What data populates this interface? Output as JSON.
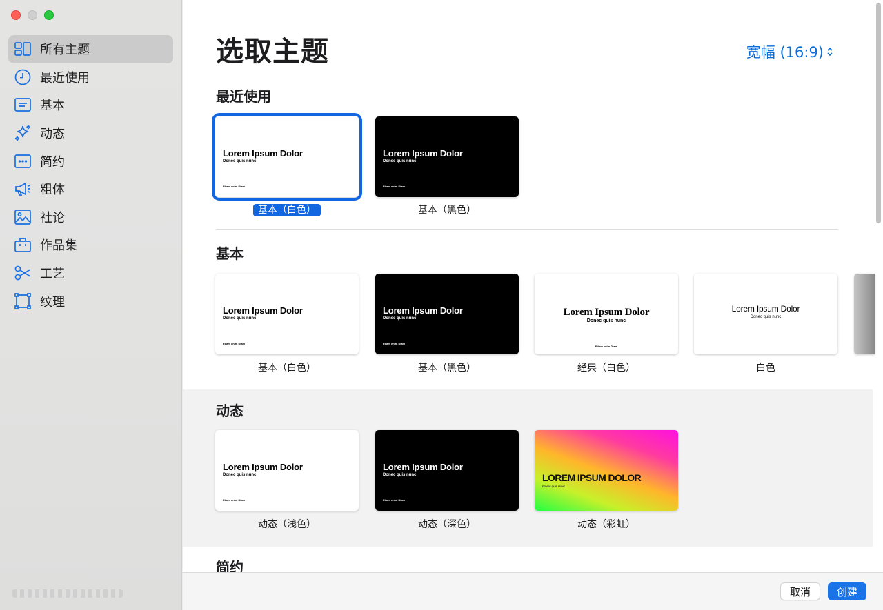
{
  "sidebar": {
    "items": [
      {
        "label": "所有主题",
        "icon": "grid-icon"
      },
      {
        "label": "最近使用",
        "icon": "clock-icon"
      },
      {
        "label": "基本",
        "icon": "text-lines-icon"
      },
      {
        "label": "动态",
        "icon": "sparkles-icon"
      },
      {
        "label": "简约",
        "icon": "dots-box-icon"
      },
      {
        "label": "粗体",
        "icon": "megaphone-icon"
      },
      {
        "label": "社论",
        "icon": "photo-icon"
      },
      {
        "label": "作品集",
        "icon": "briefcase-icon"
      },
      {
        "label": "工艺",
        "icon": "scissors-icon"
      },
      {
        "label": "纹理",
        "icon": "frame-icon"
      }
    ],
    "active_index": 0
  },
  "main": {
    "title": "选取主题",
    "ratio_label": "宽幅 (16:9)",
    "sections": {
      "recent": {
        "heading": "最近使用",
        "themes": [
          {
            "name": "基本（白色）",
            "style": "white"
          },
          {
            "name": "基本（黑色）",
            "style": "black"
          }
        ]
      },
      "basic": {
        "heading": "基本",
        "themes": [
          {
            "name": "基本（白色）",
            "style": "white"
          },
          {
            "name": "基本（黑色）",
            "style": "black"
          },
          {
            "name": "经典（白色）",
            "style": "classic"
          },
          {
            "name": "白色",
            "style": "plain"
          }
        ]
      },
      "dynamic": {
        "heading": "动态",
        "themes": [
          {
            "name": "动态（浅色）",
            "style": "light"
          },
          {
            "name": "动态（深色）",
            "style": "dark"
          },
          {
            "name": "动态（彩虹）",
            "style": "rainbow"
          }
        ]
      },
      "minimal": {
        "heading": "简约"
      }
    },
    "thumb_text": {
      "title": "Lorem Ipsum Dolor",
      "subtitle": "Donec quis nunc",
      "footer": "Etiam enim Diam",
      "title_caps": "LOREM IPSUM DOLOR",
      "subtitle_caps": "DONEC QUIS NUNC"
    }
  },
  "buttons": {
    "cancel": "取消",
    "create": "创建"
  },
  "colors": {
    "accent": "#1266e0",
    "link": "#0a6cd6"
  }
}
